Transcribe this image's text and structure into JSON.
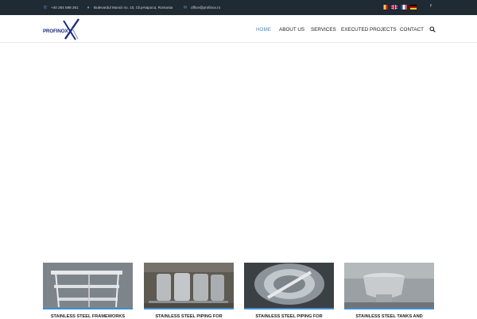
{
  "topbar": {
    "phone": "+40 264 598 261",
    "address": "Bulevardul Muncii no. 10, Cluj-Napoca, Romania",
    "email": "office@profinox.ro",
    "languages": [
      "ro",
      "en",
      "fr",
      "de"
    ],
    "social_icon": "facebook-icon"
  },
  "header": {
    "logo_text": "PROFINOX",
    "nav": [
      "HOME",
      "ABOUT US",
      "SERVICES",
      "EXECUTED PROJECTS",
      "CONTACT"
    ],
    "active_nav": "HOME",
    "search_icon": "search-icon"
  },
  "colors": {
    "topbar_bg": "#1f2a33",
    "accent": "#3f8fd1",
    "logo": "#1b2a8a"
  },
  "cards": [
    {
      "title": "STAINLESS STEEL FRAMEWORKS"
    },
    {
      "title": "STAINLESS STEEL PIPING FOR"
    },
    {
      "title": "STAINLESS STEEL PIPING FOR"
    },
    {
      "title": "STAINLESS STEEL TANKS AND"
    }
  ]
}
